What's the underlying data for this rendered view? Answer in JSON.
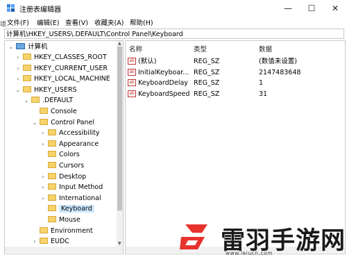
{
  "window": {
    "title": "注册表编辑器",
    "min_glyph": "—",
    "max_glyph": "☐",
    "close_glyph": "✕"
  },
  "menu": [
    "文件(F)",
    "编辑(E)",
    "查看(V)",
    "收藏夹(A)",
    "帮助(H)"
  ],
  "side_glyph": "项",
  "address": "计算机\\HKEY_USERS\\.DEFAULT\\Control Panel\\Keyboard",
  "tree": {
    "root": "计算机",
    "nodes": [
      {
        "label": "HKEY_CLASSES_ROOT",
        "expander": "›"
      },
      {
        "label": "HKEY_CURRENT_USER",
        "expander": "›"
      },
      {
        "label": "HKEY_LOCAL_MACHINE",
        "expander": "›"
      },
      {
        "label": "HKEY_USERS",
        "expander": "⌄"
      },
      {
        "label": ".DEFAULT",
        "expander": "⌄"
      },
      {
        "label": "Console",
        "expander": ""
      },
      {
        "label": "Control Panel",
        "expander": "⌄"
      },
      {
        "label": "Accessibility",
        "expander": "›"
      },
      {
        "label": "Appearance",
        "expander": "›"
      },
      {
        "label": "Colors",
        "expander": ""
      },
      {
        "label": "Cursors",
        "expander": ""
      },
      {
        "label": "Desktop",
        "expander": "›"
      },
      {
        "label": "Input Method",
        "expander": "›"
      },
      {
        "label": "International",
        "expander": "›"
      },
      {
        "label": "Keyboard",
        "expander": ""
      },
      {
        "label": "Mouse",
        "expander": ""
      },
      {
        "label": "Environment",
        "expander": ""
      },
      {
        "label": "EUDC",
        "expander": "›"
      }
    ],
    "selected": "Keyboard"
  },
  "list": {
    "headers": {
      "name": "名称",
      "type": "类型",
      "data": "数据"
    },
    "icon_text": "ab",
    "rows": [
      {
        "name": "(默认)",
        "type": "REG_SZ",
        "data": "(数值未设置)"
      },
      {
        "name": "InitialKeyboar...",
        "type": "REG_SZ",
        "data": "2147483648"
      },
      {
        "name": "KeyboardDelay",
        "type": "REG_SZ",
        "data": "1"
      },
      {
        "name": "KeyboardSpeed",
        "type": "REG_SZ",
        "data": "31"
      }
    ]
  },
  "watermark": {
    "text": "雷羽手游网",
    "url": "www.leiucn.com",
    "color": "#e8322d"
  }
}
